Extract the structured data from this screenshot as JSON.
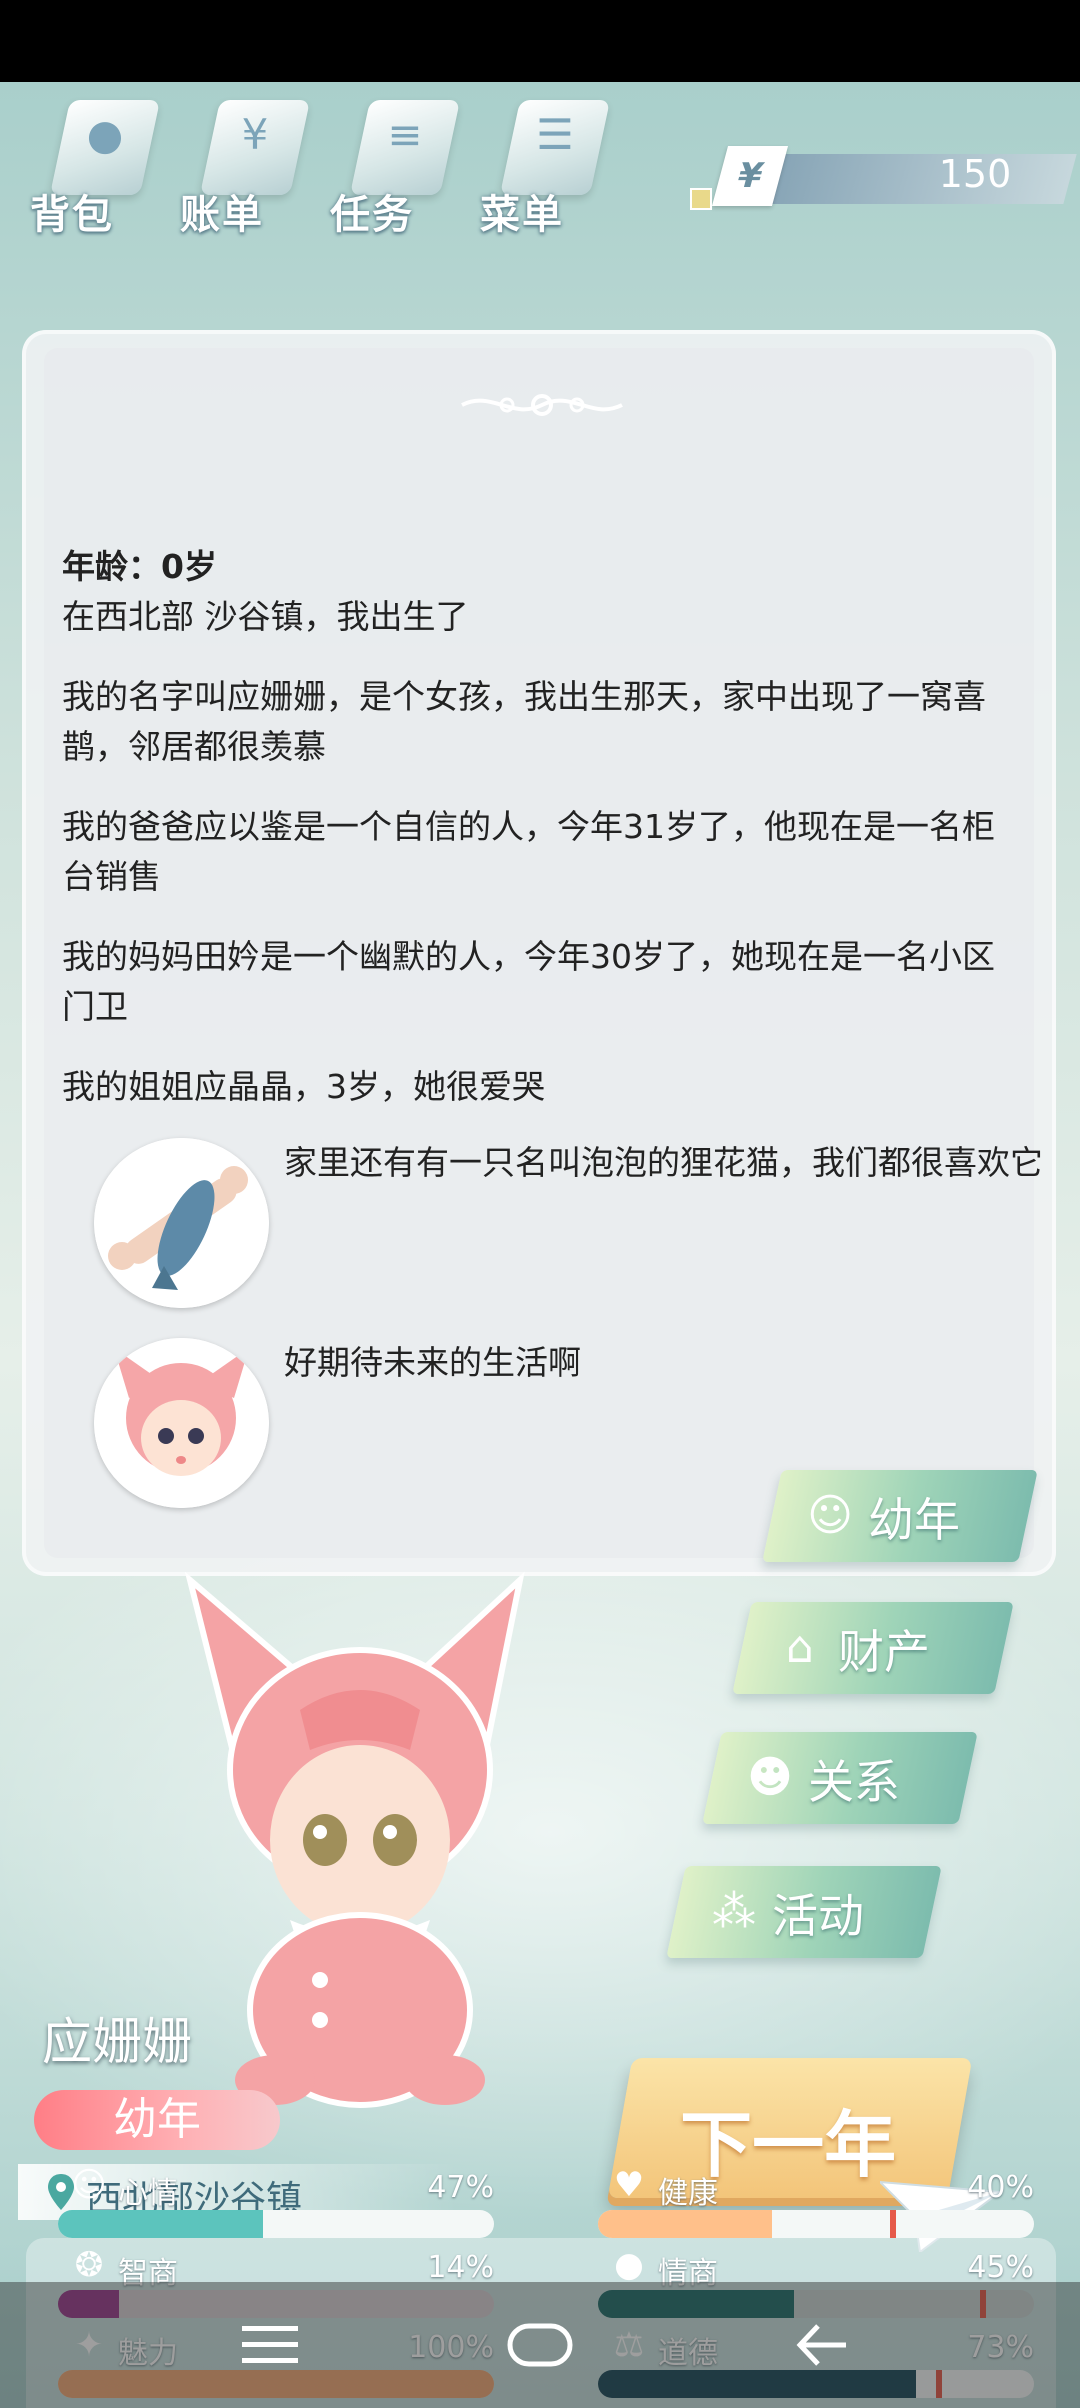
{
  "menu": [
    {
      "label": "背包",
      "icon": "bag-icon",
      "glyph": "●"
    },
    {
      "label": "账单",
      "icon": "bill-icon",
      "glyph": "¥"
    },
    {
      "label": "任务",
      "icon": "task-icon",
      "glyph": "≡"
    },
    {
      "label": "菜单",
      "icon": "menu-icon",
      "glyph": "☰"
    }
  ],
  "money": {
    "symbol": "¥",
    "value": "150"
  },
  "story": {
    "age": "年龄：0岁",
    "paragraphs": [
      "在西北部 沙谷镇，我出生了",
      "我的名字叫应姗姗，是个女孩，我出生那天，家中出现了一窝喜鹊，邻居都很羡慕",
      "我的爸爸应以鉴是一个自信的人，今年31岁了，他现在是一名柜台销售",
      "我的妈妈田妗是一个幽默的人，今年30岁了，她现在是一名小区门卫",
      "我的姐姐应晶晶，3岁，她很爱哭"
    ],
    "pet_line": "家里还有有一只名叫泡泡的狸花猫，我们都很喜欢它",
    "future_line": "好期待未来的生活啊"
  },
  "side_buttons": [
    {
      "label": "幼年",
      "icon": "baby-icon"
    },
    {
      "label": "财产",
      "icon": "house-icon"
    },
    {
      "label": "关系",
      "icon": "people-icon"
    },
    {
      "label": "活动",
      "icon": "activity-icon"
    }
  ],
  "next_button": "下一年",
  "character": {
    "name": "应姗姗",
    "stage": "幼年",
    "location": "西北部沙谷镇"
  },
  "stats": [
    {
      "label": "心情",
      "value": "47%",
      "level": 0.47,
      "color": "#5cc4bd",
      "icon": "smile-icon"
    },
    {
      "label": "健康",
      "value": "40%",
      "level": 0.4,
      "color": "#ffc08a",
      "icon": "heart-icon"
    },
    {
      "label": "智商",
      "value": "14%",
      "level": 0.14,
      "color": "#9a3b8c",
      "icon": "brain-icon"
    },
    {
      "label": "情商",
      "value": "45%",
      "level": 0.45,
      "color": "#1f6e6a",
      "icon": "apple-icon"
    },
    {
      "label": "魅力",
      "value": "100%",
      "level": 1.0,
      "color": "#f0a875",
      "icon": "sparkle-icon"
    },
    {
      "label": "道德",
      "value": "73%",
      "level": 0.73,
      "color": "#1a4a5a",
      "icon": "scale-icon"
    }
  ],
  "colors": {
    "accent": "#7dbcae",
    "badge": "#ff7e86",
    "next": "#f3c57a"
  }
}
